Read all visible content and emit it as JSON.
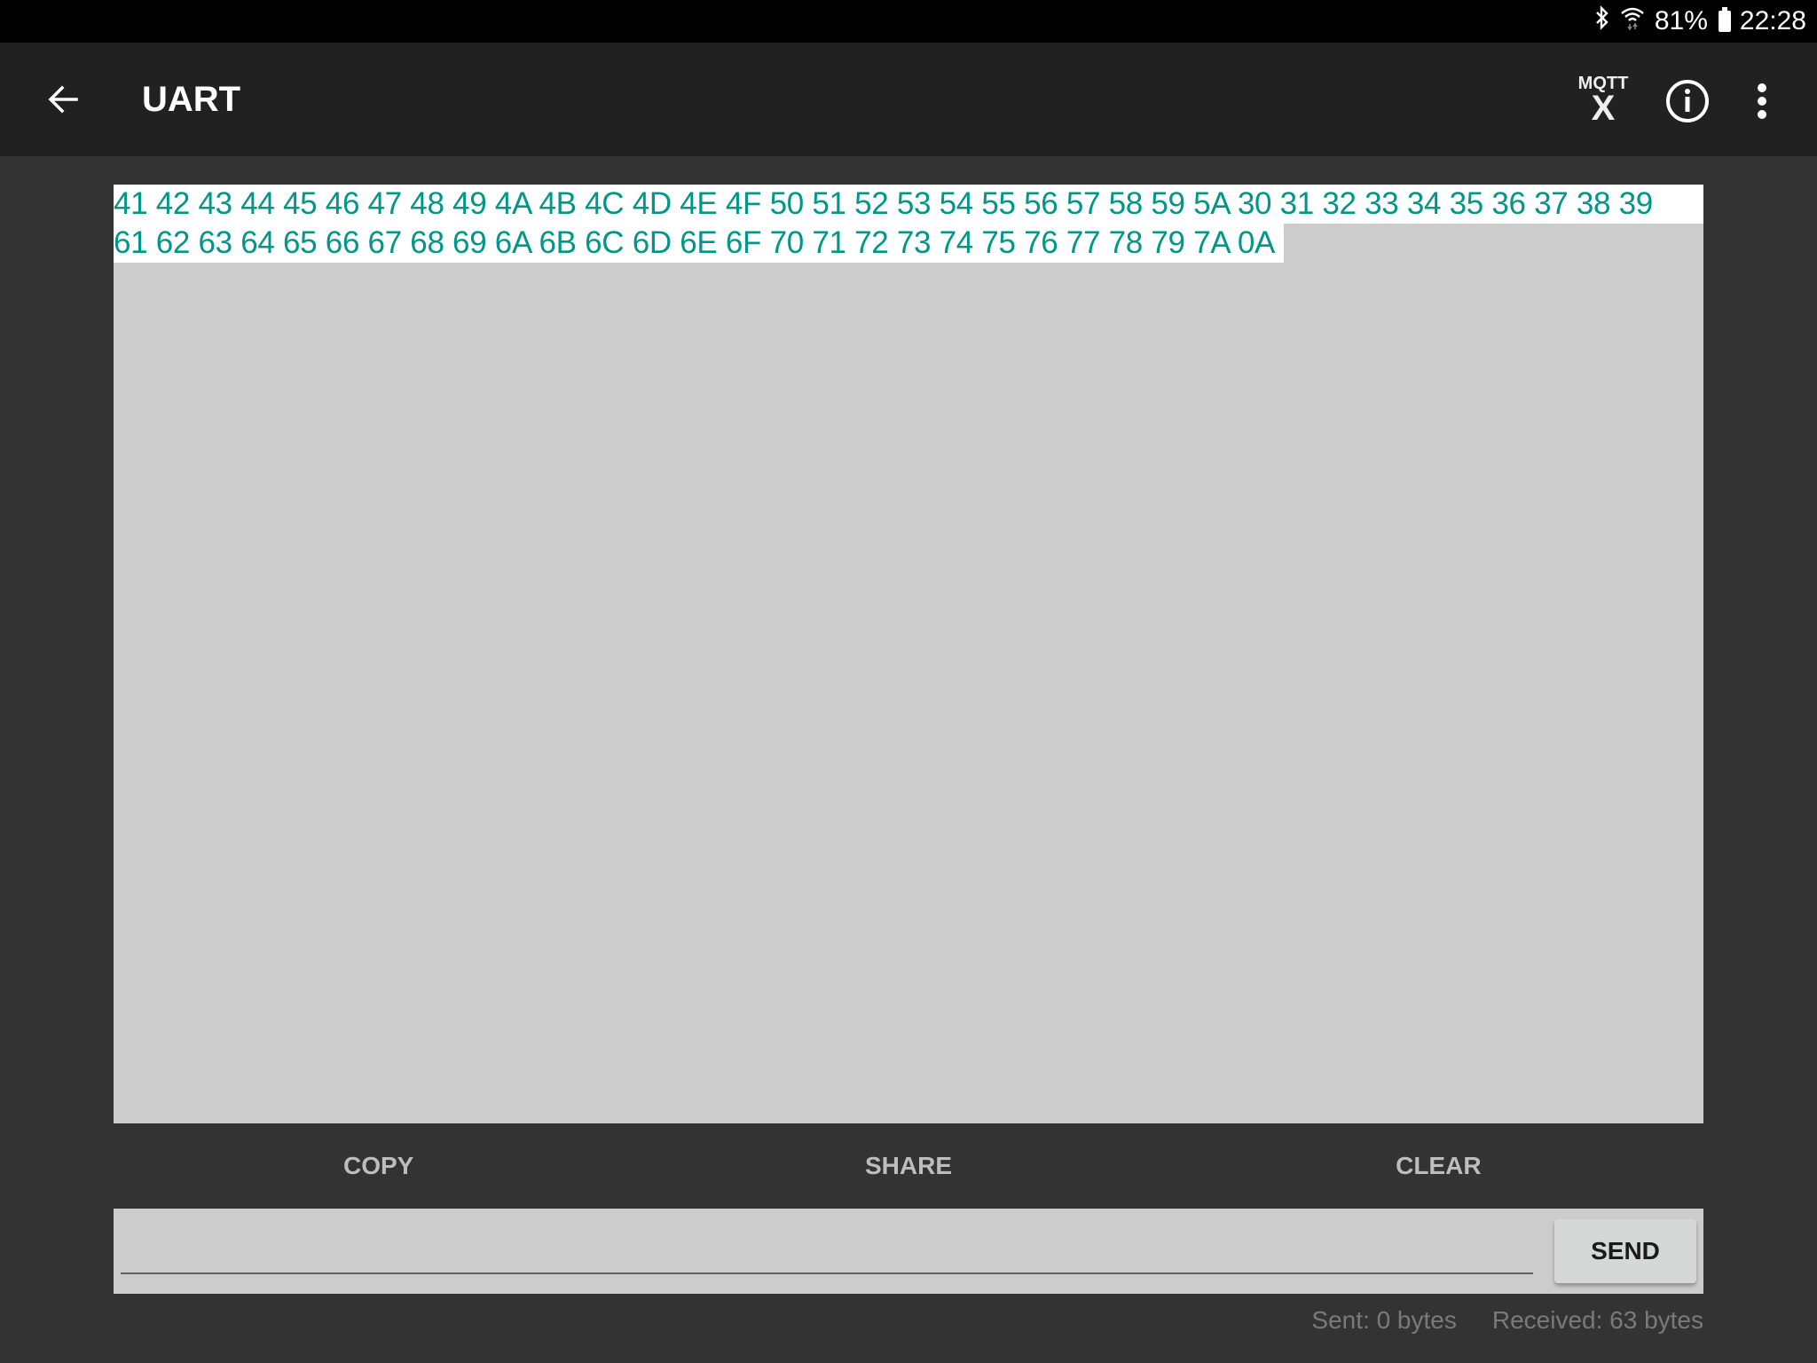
{
  "status_bar": {
    "icons": [
      "bluetooth-icon",
      "wifi-icon",
      "battery-icon"
    ],
    "battery": "81%",
    "time": "22:28"
  },
  "toolbar": {
    "back_icon": "arrow-left-icon",
    "title": "UART",
    "mqtt_label_top": "MQTT",
    "mqtt_label_bottom": "X",
    "info_icon": "info-circle-icon",
    "more_icon": "more-vertical-icon"
  },
  "log": {
    "lines": [
      "41 42 43 44 45 46 47 48 49 4A 4B 4C 4D 4E 4F 50 51 52 53 54 55 56 57 58 59 5A 30 31 32 33 34 35 36 37 38 39",
      "61 62 63 64 65 66 67 68 69 6A 6B 6C 6D 6E 6F 70 71 72 73 74 75 76 77 78 79 7A 0A"
    ],
    "text_color": "#009688"
  },
  "actions": {
    "copy": "COPY",
    "share": "SHARE",
    "clear": "CLEAR"
  },
  "input": {
    "value": "",
    "placeholder": "",
    "send_label": "SEND"
  },
  "counters": {
    "sent": "Sent: 0 bytes",
    "received": "Received: 63 bytes"
  }
}
